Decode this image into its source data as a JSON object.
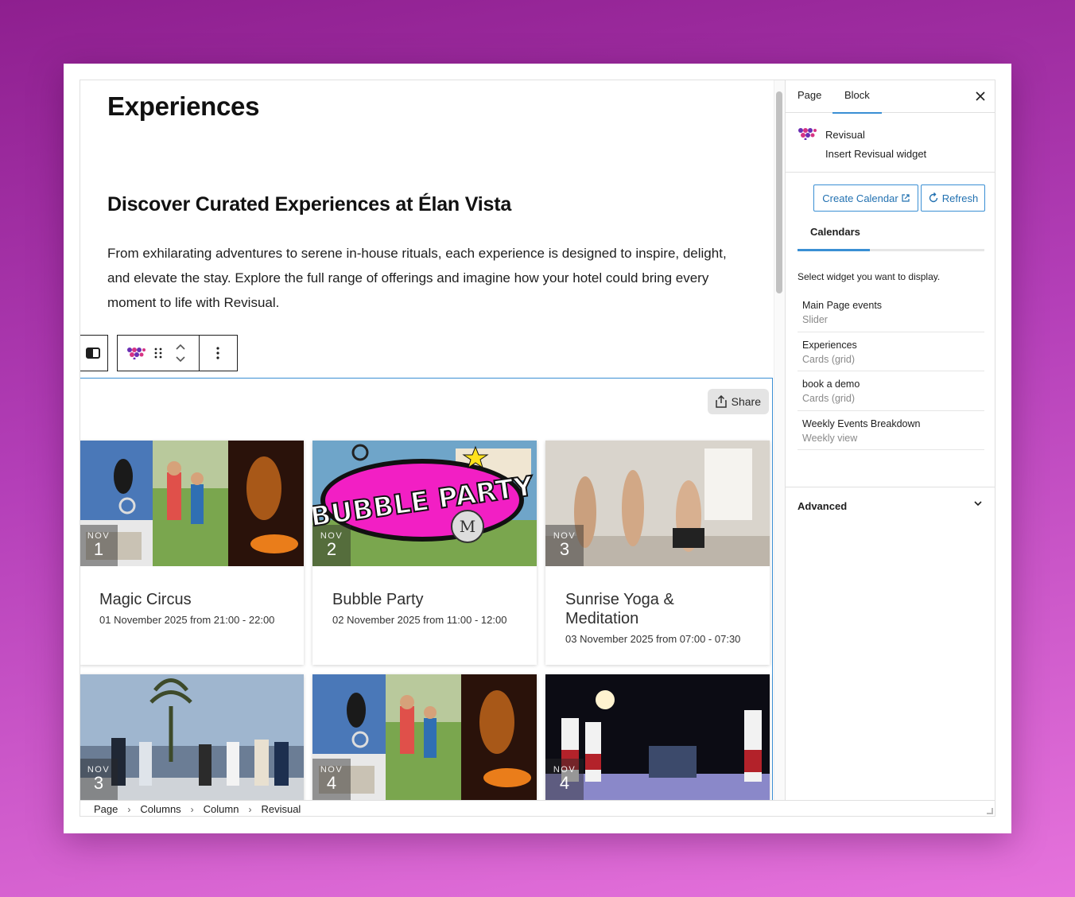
{
  "page": {
    "title": "Experiences",
    "heading": "Discover Curated Experiences at Élan Vista",
    "paragraph": "From exhilarating adventures to serene in-house rituals, each experience is designed to inspire, delight, and elevate the stay. Explore the full range of offerings and imagine how your hotel could bring every moment to life with Revisual."
  },
  "widget": {
    "share_label": "Share",
    "cards": [
      {
        "month": "NOV",
        "day": "1",
        "title": "Magic Circus",
        "date": "01 November 2025 from 21:00 - 22:00"
      },
      {
        "month": "NOV",
        "day": "2",
        "title": "Bubble Party",
        "date": "02 November 2025 from 11:00 - 12:00"
      },
      {
        "month": "NOV",
        "day": "3",
        "title": "Sunrise Yoga & Meditation",
        "date": "03 November 2025 from 07:00 - 07:30"
      },
      {
        "month": "NOV",
        "day": "3"
      },
      {
        "month": "NOV",
        "day": "4"
      },
      {
        "month": "NOV",
        "day": "4"
      }
    ],
    "bubble_party_art_text": "BUBBLE PARTY"
  },
  "breadcrumb": [
    "Page",
    "Columns",
    "Column",
    "Revisual"
  ],
  "sidebar": {
    "tabs": [
      "Page",
      "Block"
    ],
    "active_tab": "Block",
    "block_name": "Revisual",
    "block_description": "Insert Revisual widget",
    "create_calendar_label": "Create Calendar",
    "refresh_label": "Refresh",
    "calendars_tab": "Calendars",
    "select_hint": "Select widget you want to display.",
    "widgets": [
      {
        "name": "Main Page events",
        "type": "Slider"
      },
      {
        "name": "Experiences",
        "type": "Cards (grid)"
      },
      {
        "name": "book a demo",
        "type": "Cards (grid)"
      },
      {
        "name": "Weekly Events Breakdown",
        "type": "Weekly view"
      }
    ],
    "advanced_label": "Advanced"
  },
  "colors": {
    "accent": "#3a8fd4",
    "link": "#2271b1",
    "brand_purple": "#6b2fb3",
    "brand_pink": "#d63384",
    "background_top": "#8e1f8f",
    "background_bottom": "#e673dc"
  },
  "icons": {
    "columns_block": "columns-icon",
    "revisual_logo": "revisual-logo-icon",
    "drag": "drag-handle-icon",
    "move": "move-up-down-icon",
    "more": "more-options-icon",
    "share": "share-icon",
    "close": "close-icon",
    "external": "external-link-icon",
    "refresh": "refresh-icon",
    "chevron": "chevron-down-icon"
  }
}
